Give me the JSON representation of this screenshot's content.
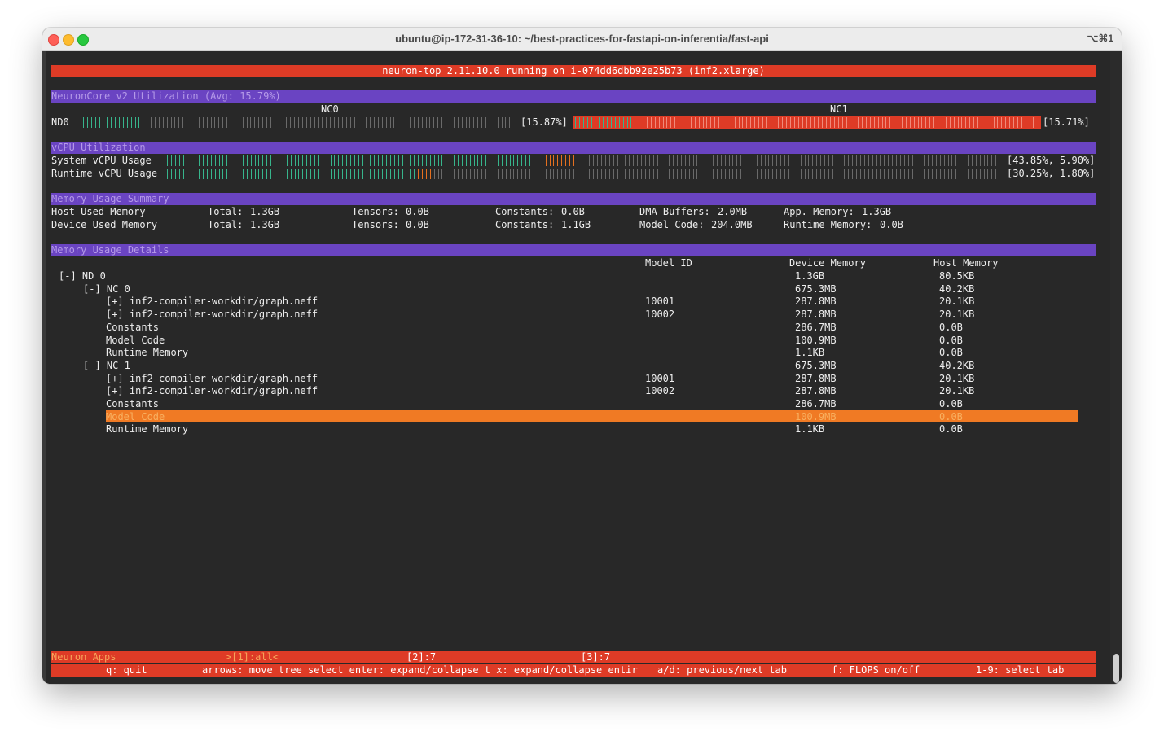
{
  "window": {
    "title": "ubuntu@ip-172-31-36-10: ~/best-practices-for-fastapi-on-inferentia/fast-api",
    "shortcut": "⌥⌘1"
  },
  "header": {
    "text": "neuron-top 2.11.10.0 running on i-074dd6dbb92e25b73 (inf2.xlarge)"
  },
  "neuroncore": {
    "section_title": "NeuronCore v2 Utilization (Avg: 15.79%)",
    "nc0_label": "NC0",
    "nc1_label": "NC1",
    "device_label": "ND0",
    "nc0_value": "[15.87%]",
    "nc1_value": "[15.71%]",
    "nc0_fraction": 0.1587,
    "nc1_fraction": 0.1571
  },
  "vcpu": {
    "section_title": "vCPU Utilization",
    "system_label": "System vCPU Usage",
    "system_value": "[43.85%, 5.90%]",
    "system_user_fraction": 0.4385,
    "system_sys_fraction": 0.059,
    "runtime_label": "Runtime vCPU Usage",
    "runtime_value": "[30.25%, 1.80%]",
    "runtime_user_fraction": 0.3025,
    "runtime_sys_fraction": 0.018
  },
  "memory_summary": {
    "section_title": "Memory Usage Summary",
    "host": {
      "label": "Host Used Memory",
      "total_label": "Total:",
      "total": "1.3GB",
      "tensors_label": "Tensors:",
      "tensors": "0.0B",
      "constants_label": "Constants:",
      "constants": "0.0B",
      "dma_label": "DMA Buffers:",
      "dma": "2.0MB",
      "app_label": "App. Memory:",
      "app": "1.3GB"
    },
    "device": {
      "label": "Device Used Memory",
      "total_label": "Total:",
      "total": "1.3GB",
      "tensors_label": "Tensors:",
      "tensors": "0.0B",
      "constants_label": "Constants:",
      "constants": "1.1GB",
      "code_label": "Model Code:",
      "code": "204.0MB",
      "runtime_label": "Runtime Memory:",
      "runtime": "0.0B"
    }
  },
  "memory_details": {
    "section_title": "Memory Usage Details",
    "col_model_id": "Model ID",
    "col_device_memory": "Device Memory",
    "col_host_memory": "Host Memory",
    "rows": [
      {
        "label": "[-] ND 0",
        "model_id": "",
        "device": "1.3GB",
        "host": "80.5KB"
      },
      {
        "label": "[-] NC 0",
        "model_id": "",
        "device": "675.3MB",
        "host": "40.2KB"
      },
      {
        "label": "[+] inf2-compiler-workdir/graph.neff",
        "model_id": "10001",
        "device": "287.8MB",
        "host": "20.1KB"
      },
      {
        "label": "[+] inf2-compiler-workdir/graph.neff",
        "model_id": "10002",
        "device": "287.8MB",
        "host": "20.1KB"
      },
      {
        "label": "Constants",
        "model_id": "",
        "device": "286.7MB",
        "host": "0.0B"
      },
      {
        "label": "Model Code",
        "model_id": "",
        "device": "100.9MB",
        "host": "0.0B"
      },
      {
        "label": "Runtime Memory",
        "model_id": "",
        "device": "1.1KB",
        "host": "0.0B"
      },
      {
        "label": "[-] NC 1",
        "model_id": "",
        "device": "675.3MB",
        "host": "40.2KB"
      },
      {
        "label": "[+] inf2-compiler-workdir/graph.neff",
        "model_id": "10001",
        "device": "287.8MB",
        "host": "20.1KB"
      },
      {
        "label": "[+] inf2-compiler-workdir/graph.neff",
        "model_id": "10002",
        "device": "287.8MB",
        "host": "20.1KB"
      },
      {
        "label": "Constants",
        "model_id": "",
        "device": "286.7MB",
        "host": "0.0B"
      },
      {
        "label": "Model Code",
        "model_id": "",
        "device": "100.9MB",
        "host": "0.0B"
      },
      {
        "label": "Runtime Memory",
        "model_id": "",
        "device": "1.1KB",
        "host": "0.0B"
      }
    ]
  },
  "footer": {
    "apps_label": "Neuron Apps",
    "tab1": ">[1]:all<",
    "tab2": "[2]:7",
    "tab3": "[3]:7",
    "help_quit": "q: quit",
    "help_arrows": "arrows: move tree select enter: expand/collapse t x: expand/collapse entir",
    "help_ad": "a/d: previous/next tab",
    "help_flops": "f: FLOPS on/off",
    "help_select": "1-9: select tab"
  }
}
